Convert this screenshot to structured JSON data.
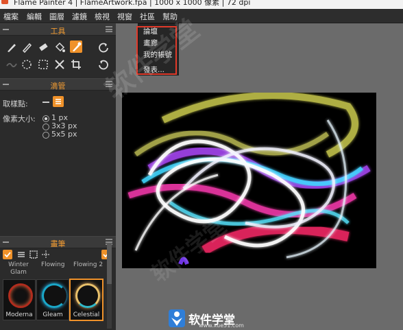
{
  "window": {
    "title": "Flame Painter 4 | FlameArtwork.fpa | 1000 x 1000 像素 | 72 dpi"
  },
  "menubar": {
    "items": [
      "檔案",
      "編輯",
      "圖層",
      "濾鏡",
      "檢視",
      "視窗",
      "社區",
      "幫助"
    ]
  },
  "community_menu": {
    "items": [
      "論壇",
      "畫廊",
      "我的帳號",
      "發表..."
    ]
  },
  "tools_panel": {
    "title": "工具",
    "row1": [
      "brush-icon",
      "pen-icon",
      "eraser-icon",
      "fill-icon",
      "eyedropper-icon",
      "rotate-icon"
    ],
    "row2": [
      "smudge-icon",
      "pattern-icon",
      "selection-icon",
      "move-icon",
      "crop-icon",
      "redo-icon"
    ]
  },
  "dropper_panel": {
    "title": "滴管",
    "sample_label": "取樣點:",
    "size_label": "像素大小:",
    "size_options": [
      "1 px",
      "3x3 px",
      "5x5 px"
    ],
    "selected_size": "1 px"
  },
  "brush_panel": {
    "title": "畫筆",
    "row_labels": [
      "Winter Glam",
      "Flowing",
      "Flowing 2"
    ],
    "thumbnails": [
      {
        "label": "Moderna",
        "selected": false
      },
      {
        "label": "Gleam",
        "selected": false
      },
      {
        "label": "Celestial",
        "selected": true
      }
    ]
  },
  "watermark": {
    "logo_text": "软件学堂",
    "url": "www.xue51.com",
    "overlay": "软件学堂"
  }
}
